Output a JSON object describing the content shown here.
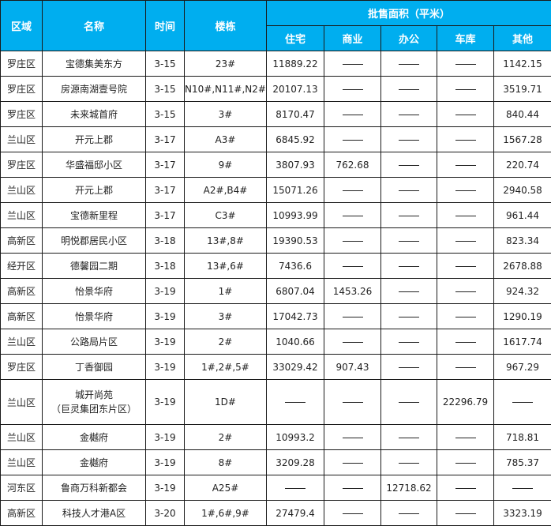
{
  "table": {
    "headers": {
      "district": "区域",
      "name": "名称",
      "date": "时间",
      "buildings": "楼栋",
      "group": "批售面积（平米）",
      "residential": "住宅",
      "commercial": "商业",
      "office": "办公",
      "garage": "车库",
      "other": "其他"
    },
    "empty_marker": "——",
    "header_color": "#00aeef",
    "rows": [
      {
        "district": "罗庄区",
        "name": [
          "宝德集美东方"
        ],
        "date": "3-15",
        "buildings": "23#",
        "residential": "11889.22",
        "commercial": "",
        "office": "",
        "garage": "",
        "other": "1142.15"
      },
      {
        "district": "罗庄区",
        "name": [
          "房源南湖壹号院"
        ],
        "date": "3-15",
        "buildings": "N10#,N11#,N2#",
        "residential": "20107.13",
        "commercial": "",
        "office": "",
        "garage": "",
        "other": "3519.71"
      },
      {
        "district": "罗庄区",
        "name": [
          "未来城首府"
        ],
        "date": "3-15",
        "buildings": "3#",
        "residential": "8170.47",
        "commercial": "",
        "office": "",
        "garage": "",
        "other": "840.44"
      },
      {
        "district": "兰山区",
        "name": [
          "开元上郡"
        ],
        "date": "3-17",
        "buildings": "A3#",
        "residential": "6845.92",
        "commercial": "",
        "office": "",
        "garage": "",
        "other": "1567.28"
      },
      {
        "district": "罗庄区",
        "name": [
          "华盛福邸小区"
        ],
        "date": "3-17",
        "buildings": "9#",
        "residential": "3807.93",
        "commercial": "762.68",
        "office": "",
        "garage": "",
        "other": "220.74"
      },
      {
        "district": "兰山区",
        "name": [
          "开元上郡"
        ],
        "date": "3-17",
        "buildings": "A2#,B4#",
        "residential": "15071.26",
        "commercial": "",
        "office": "",
        "garage": "",
        "other": "2940.58"
      },
      {
        "district": "兰山区",
        "name": [
          "宝德新里程"
        ],
        "date": "3-17",
        "buildings": "C3#",
        "residential": "10993.99",
        "commercial": "",
        "office": "",
        "garage": "",
        "other": "961.44"
      },
      {
        "district": "高新区",
        "name": [
          "明悦郡居民小区"
        ],
        "date": "3-18",
        "buildings": "13#,8#",
        "residential": "19390.53",
        "commercial": "",
        "office": "",
        "garage": "",
        "other": "823.34"
      },
      {
        "district": "经开区",
        "name": [
          "德馨园二期"
        ],
        "date": "3-18",
        "buildings": "13#,6#",
        "residential": "7436.6",
        "commercial": "",
        "office": "",
        "garage": "",
        "other": "2678.88"
      },
      {
        "district": "高新区",
        "name": [
          "怡景华府"
        ],
        "date": "3-19",
        "buildings": "1#",
        "residential": "6807.04",
        "commercial": "1453.26",
        "office": "",
        "garage": "",
        "other": "924.32"
      },
      {
        "district": "高新区",
        "name": [
          "怡景华府"
        ],
        "date": "3-19",
        "buildings": "3#",
        "residential": "17042.73",
        "commercial": "",
        "office": "",
        "garage": "",
        "other": "1290.19"
      },
      {
        "district": "兰山区",
        "name": [
          "公路局片区"
        ],
        "date": "3-19",
        "buildings": "2#",
        "residential": "1040.66",
        "commercial": "",
        "office": "",
        "garage": "",
        "other": "1617.74"
      },
      {
        "district": "罗庄区",
        "name": [
          "丁香御园"
        ],
        "date": "3-19",
        "buildings": "1#,2#,5#",
        "residential": "33029.42",
        "commercial": "907.43",
        "office": "",
        "garage": "",
        "other": "967.29"
      },
      {
        "district": "兰山区",
        "name": [
          "城开尚苑",
          "（巨灵集团东片区）"
        ],
        "date": "3-19",
        "buildings": "1D#",
        "residential": "",
        "commercial": "",
        "office": "",
        "garage": "22296.79",
        "other": ""
      },
      {
        "district": "兰山区",
        "name": [
          "金樾府"
        ],
        "date": "3-19",
        "buildings": "2#",
        "residential": "10993.2",
        "commercial": "",
        "office": "",
        "garage": "",
        "other": "718.81"
      },
      {
        "district": "兰山区",
        "name": [
          "金樾府"
        ],
        "date": "3-19",
        "buildings": "8#",
        "residential": "3209.28",
        "commercial": "",
        "office": "",
        "garage": "",
        "other": "785.37"
      },
      {
        "district": "河东区",
        "name": [
          "鲁商万科新都会"
        ],
        "date": "3-19",
        "buildings": "A25#",
        "residential": "",
        "commercial": "",
        "office": "12718.62",
        "garage": "",
        "other": ""
      },
      {
        "district": "高新区",
        "name": [
          "科技人才港A区"
        ],
        "date": "3-20",
        "buildings": "1#,6#,9#",
        "residential": "27479.4",
        "commercial": "",
        "office": "",
        "garage": "",
        "other": "3323.19"
      }
    ]
  }
}
